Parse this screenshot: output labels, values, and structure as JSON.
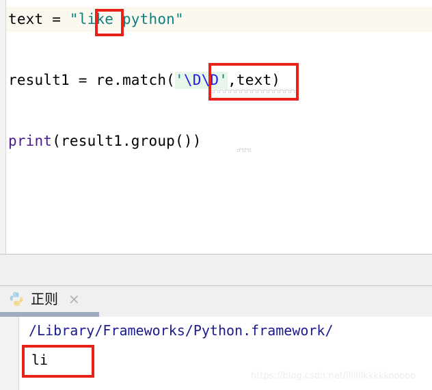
{
  "editor": {
    "lines": [
      {
        "id": "line1",
        "plain_prefix": "text = ",
        "string_open_quote": "\"",
        "string_boxed": "li",
        "string_rest": "ke python",
        "string_close_quote": "\"",
        "full_text": "text = \"like python\""
      },
      {
        "id": "line2",
        "plain_prefix": "result1 = re.match(",
        "regex_open_quote": "'",
        "regex_escape_1": "\\D",
        "regex_escape_2": "\\D",
        "regex_close_quote": "'",
        "plain_suffix": ",text)",
        "full_text": "result1 = re.match('\\D\\D',text)"
      },
      {
        "id": "line3",
        "builtin": "print",
        "plain_rest": "(result1.group())",
        "full_text": "print(result1.group())"
      }
    ],
    "colors": {
      "string": "#108080",
      "escape": "#1f1fe0",
      "builtin": "#4b1a8f",
      "plain": "#000000",
      "current_line_background": "#faf8ef",
      "regex_highlight_background": "#e8f5e9",
      "squiggle": "#b9b9c4"
    }
  },
  "run_panel": {
    "tab": {
      "icon": "python-logo-icon",
      "label": "正则",
      "close_label": "×"
    },
    "active_underline_color": "#9facbf"
  },
  "console": {
    "lines": [
      {
        "text": "/Library/Frameworks/Python.framework/",
        "color": "#1a1a8c"
      },
      {
        "text": "li",
        "color": "#000000"
      }
    ]
  },
  "annotations": {
    "color": "#e8211b",
    "boxes": [
      {
        "name": "redbox-like",
        "target": "li"
      },
      {
        "name": "redbox-regex",
        "target": "'\\D\\D'"
      },
      {
        "name": "redbox-out",
        "target": "li"
      }
    ]
  },
  "watermark": {
    "text": "https://blog.csdn.net/lllllllkkkkkooooo"
  }
}
